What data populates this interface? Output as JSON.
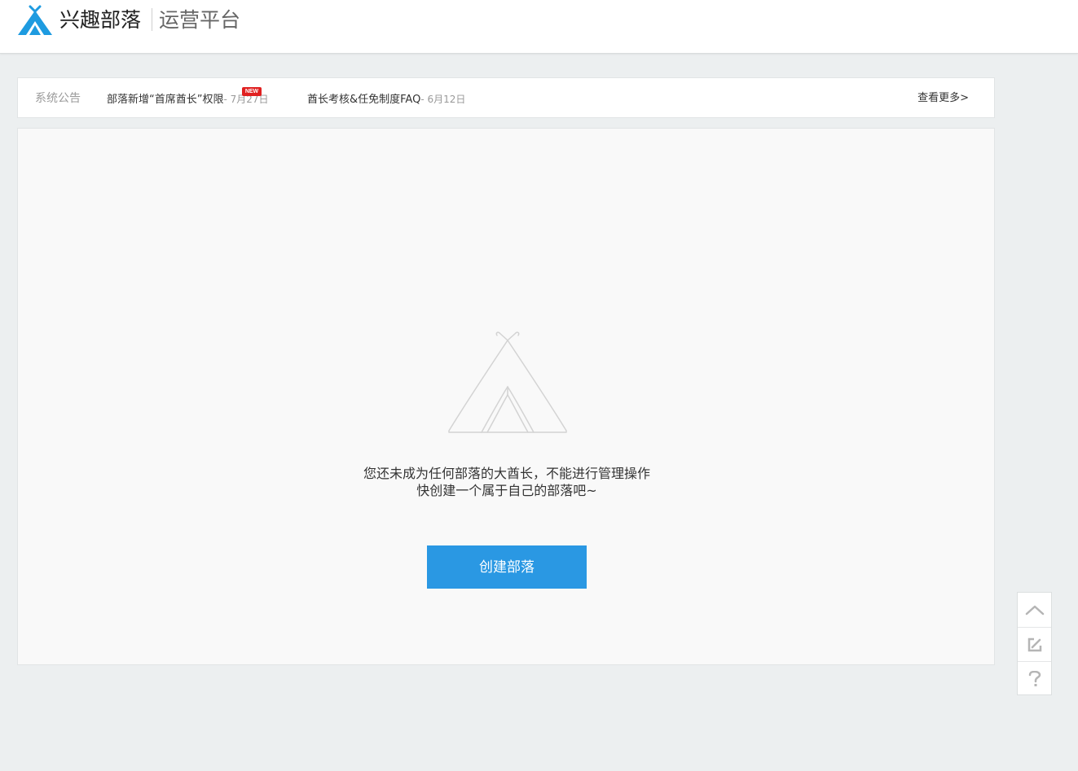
{
  "header": {
    "brand": "兴趣部落",
    "platform": "运营平台"
  },
  "notice": {
    "label": "系统公告",
    "items": [
      {
        "title": "部落新增“首席酋长”权限",
        "date": "- 7月27日",
        "badge": "NEW"
      },
      {
        "title": "酋长考核&任免制度FAQ",
        "date": "- 6月12日"
      }
    ],
    "more": "查看更多>"
  },
  "main": {
    "empty_line1": "您还未成为任何部落的大酋长，不能进行管理操作",
    "empty_line2": "快创建一个属于自己的部落吧~",
    "create_button": "创建部落"
  },
  "floatbar": {
    "icons": [
      "chevron-up-icon",
      "edit-icon",
      "help-icon"
    ]
  },
  "colors": {
    "brand_blue": "#2a98e3",
    "badge_red": "#e02020",
    "background": "#eceff0"
  }
}
